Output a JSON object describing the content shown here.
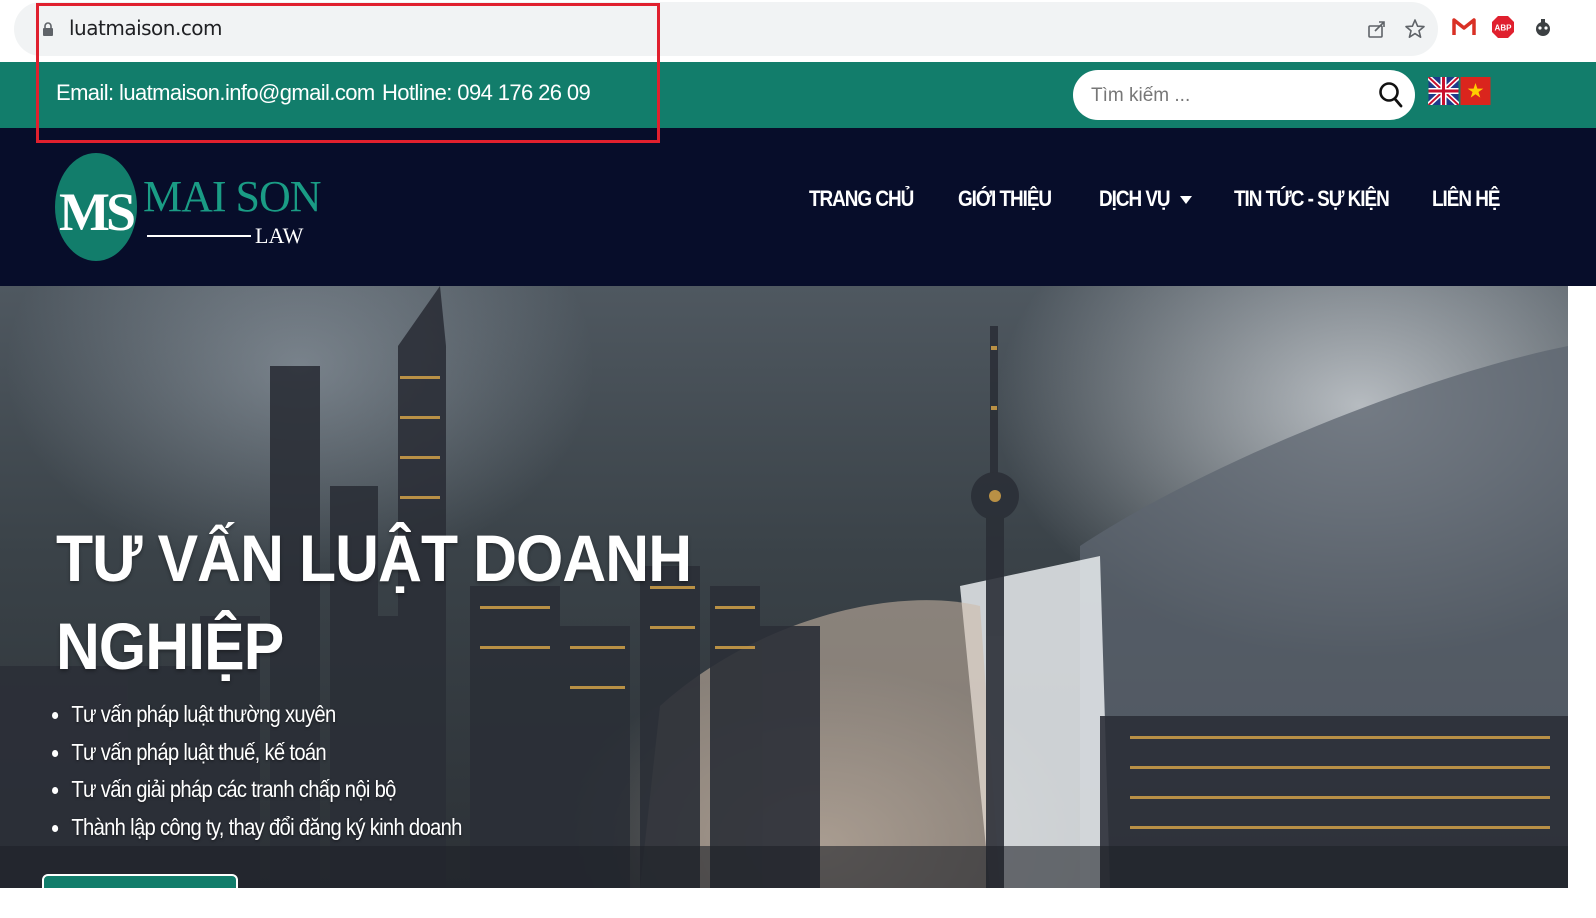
{
  "browser": {
    "url": "luatmaison.com",
    "icons": [
      "lock-icon",
      "share-icon",
      "bookmark-star-icon",
      "gmail-icon",
      "adblock-plus-icon",
      "extension-icon"
    ]
  },
  "topbar": {
    "email": "Email: luatmaison.info@gmail.com",
    "hotline": "Hotline: 094 176 26 09",
    "search_placeholder": "Tìm kiếm ...",
    "languages": [
      "english-flag-icon",
      "vietnam-flag-icon"
    ]
  },
  "logo": {
    "monogram": "MS",
    "name": "MAI SON",
    "sub": "LAW"
  },
  "nav": {
    "items": [
      {
        "label": "TRANG CHỦ"
      },
      {
        "label": "GIỚI THIỆU"
      },
      {
        "label": "DỊCH VỤ"
      },
      {
        "label": "TIN TỨC - SỰ KIỆN"
      },
      {
        "label": "LIÊN HỆ"
      }
    ]
  },
  "hero": {
    "title_line1": "TƯ VẤN LUẬT DOANH",
    "title_line2": "NGHIỆP",
    "bullets": [
      "Tư vấn pháp luật thường xuyên",
      "Tư vấn pháp luật thuế, kế toán",
      "Tư vấn giải pháp các tranh chấp nội bộ",
      "Thành lập công ty, thay đổi đăng ký kinh doanh"
    ]
  },
  "colors": {
    "brand_green": "#127d6b",
    "nav_background": "#070d2a",
    "highlight_red": "#e0202e"
  }
}
